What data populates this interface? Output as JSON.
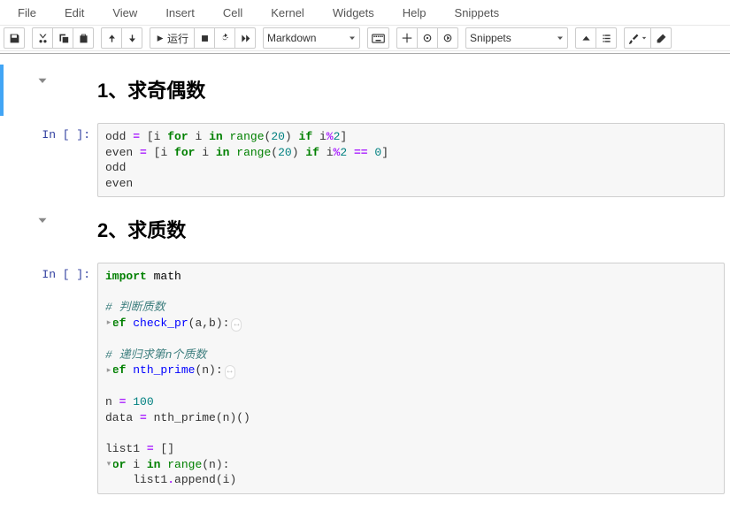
{
  "menu": {
    "items": [
      "File",
      "Edit",
      "View",
      "Insert",
      "Cell",
      "Kernel",
      "Widgets",
      "Help",
      "Snippets"
    ]
  },
  "toolbar": {
    "run_label": "运行",
    "celltype": "Markdown",
    "snippets": "Snippets"
  },
  "cells": [
    {
      "type": "markdown",
      "selected": true,
      "heading": "1、求奇偶数"
    },
    {
      "type": "code",
      "prompt": "In [ ]:",
      "lines": [
        [
          {
            "t": "odd "
          },
          {
            "t": "=",
            "c": "op"
          },
          {
            "t": " ["
          },
          {
            "t": "i "
          },
          {
            "t": "for",
            "c": "k"
          },
          {
            "t": " i "
          },
          {
            "t": "in",
            "c": "k"
          },
          {
            "t": " "
          },
          {
            "t": "range",
            "c": "nb"
          },
          {
            "t": "("
          },
          {
            "t": "20",
            "c": "m"
          },
          {
            "t": ") "
          },
          {
            "t": "if",
            "c": "k"
          },
          {
            "t": " i"
          },
          {
            "t": "%",
            "c": "op"
          },
          {
            "t": "2",
            "c": "m"
          },
          {
            "t": "]"
          }
        ],
        [
          {
            "t": "even "
          },
          {
            "t": "=",
            "c": "op"
          },
          {
            "t": " ["
          },
          {
            "t": "i "
          },
          {
            "t": "for",
            "c": "k"
          },
          {
            "t": " i "
          },
          {
            "t": "in",
            "c": "k"
          },
          {
            "t": " "
          },
          {
            "t": "range",
            "c": "nb"
          },
          {
            "t": "("
          },
          {
            "t": "20",
            "c": "m"
          },
          {
            "t": ") "
          },
          {
            "t": "if",
            "c": "k"
          },
          {
            "t": " i"
          },
          {
            "t": "%",
            "c": "op"
          },
          {
            "t": "2",
            "c": "m"
          },
          {
            "t": " "
          },
          {
            "t": "==",
            "c": "op"
          },
          {
            "t": " "
          },
          {
            "t": "0",
            "c": "m"
          },
          {
            "t": "]"
          }
        ],
        [
          {
            "t": "odd"
          }
        ],
        [
          {
            "t": "even"
          }
        ]
      ]
    },
    {
      "type": "markdown",
      "heading": "2、求质数"
    },
    {
      "type": "code",
      "prompt": "In [ ]:",
      "lines": [
        [
          {
            "t": "import",
            "c": "k"
          },
          {
            "t": " math",
            "c": "nn"
          }
        ],
        "",
        [
          {
            "t": "# 判断质数",
            "c": "c"
          }
        ],
        [
          {
            "fold": "right"
          },
          {
            "t": "def",
            "c": "k"
          },
          {
            "t": " "
          },
          {
            "t": "check_pr",
            "c": "nf"
          },
          {
            "t": "(a,b):"
          },
          {
            "folded": true
          }
        ],
        "",
        [
          {
            "t": "# 递归求第n个质数",
            "c": "c"
          }
        ],
        [
          {
            "fold": "right"
          },
          {
            "t": "def",
            "c": "k"
          },
          {
            "t": " "
          },
          {
            "t": "nth_prime",
            "c": "nf"
          },
          {
            "t": "(n):"
          },
          {
            "folded": true
          }
        ],
        "",
        [
          {
            "t": "n "
          },
          {
            "t": "=",
            "c": "op"
          },
          {
            "t": " "
          },
          {
            "t": "100",
            "c": "m"
          }
        ],
        [
          {
            "t": "data "
          },
          {
            "t": "=",
            "c": "op"
          },
          {
            "t": " nth_prime(n)()"
          }
        ],
        "",
        [
          {
            "t": "list1 "
          },
          {
            "t": "=",
            "c": "op"
          },
          {
            "t": " []"
          }
        ],
        [
          {
            "fold": "down"
          },
          {
            "t": "for",
            "c": "k"
          },
          {
            "t": " i "
          },
          {
            "t": "in",
            "c": "k"
          },
          {
            "t": " "
          },
          {
            "t": "range",
            "c": "nb"
          },
          {
            "t": "(n):"
          }
        ],
        [
          {
            "t": "    list1"
          },
          {
            "t": ".",
            "c": "op"
          },
          {
            "t": "append(i)"
          }
        ]
      ]
    }
  ]
}
